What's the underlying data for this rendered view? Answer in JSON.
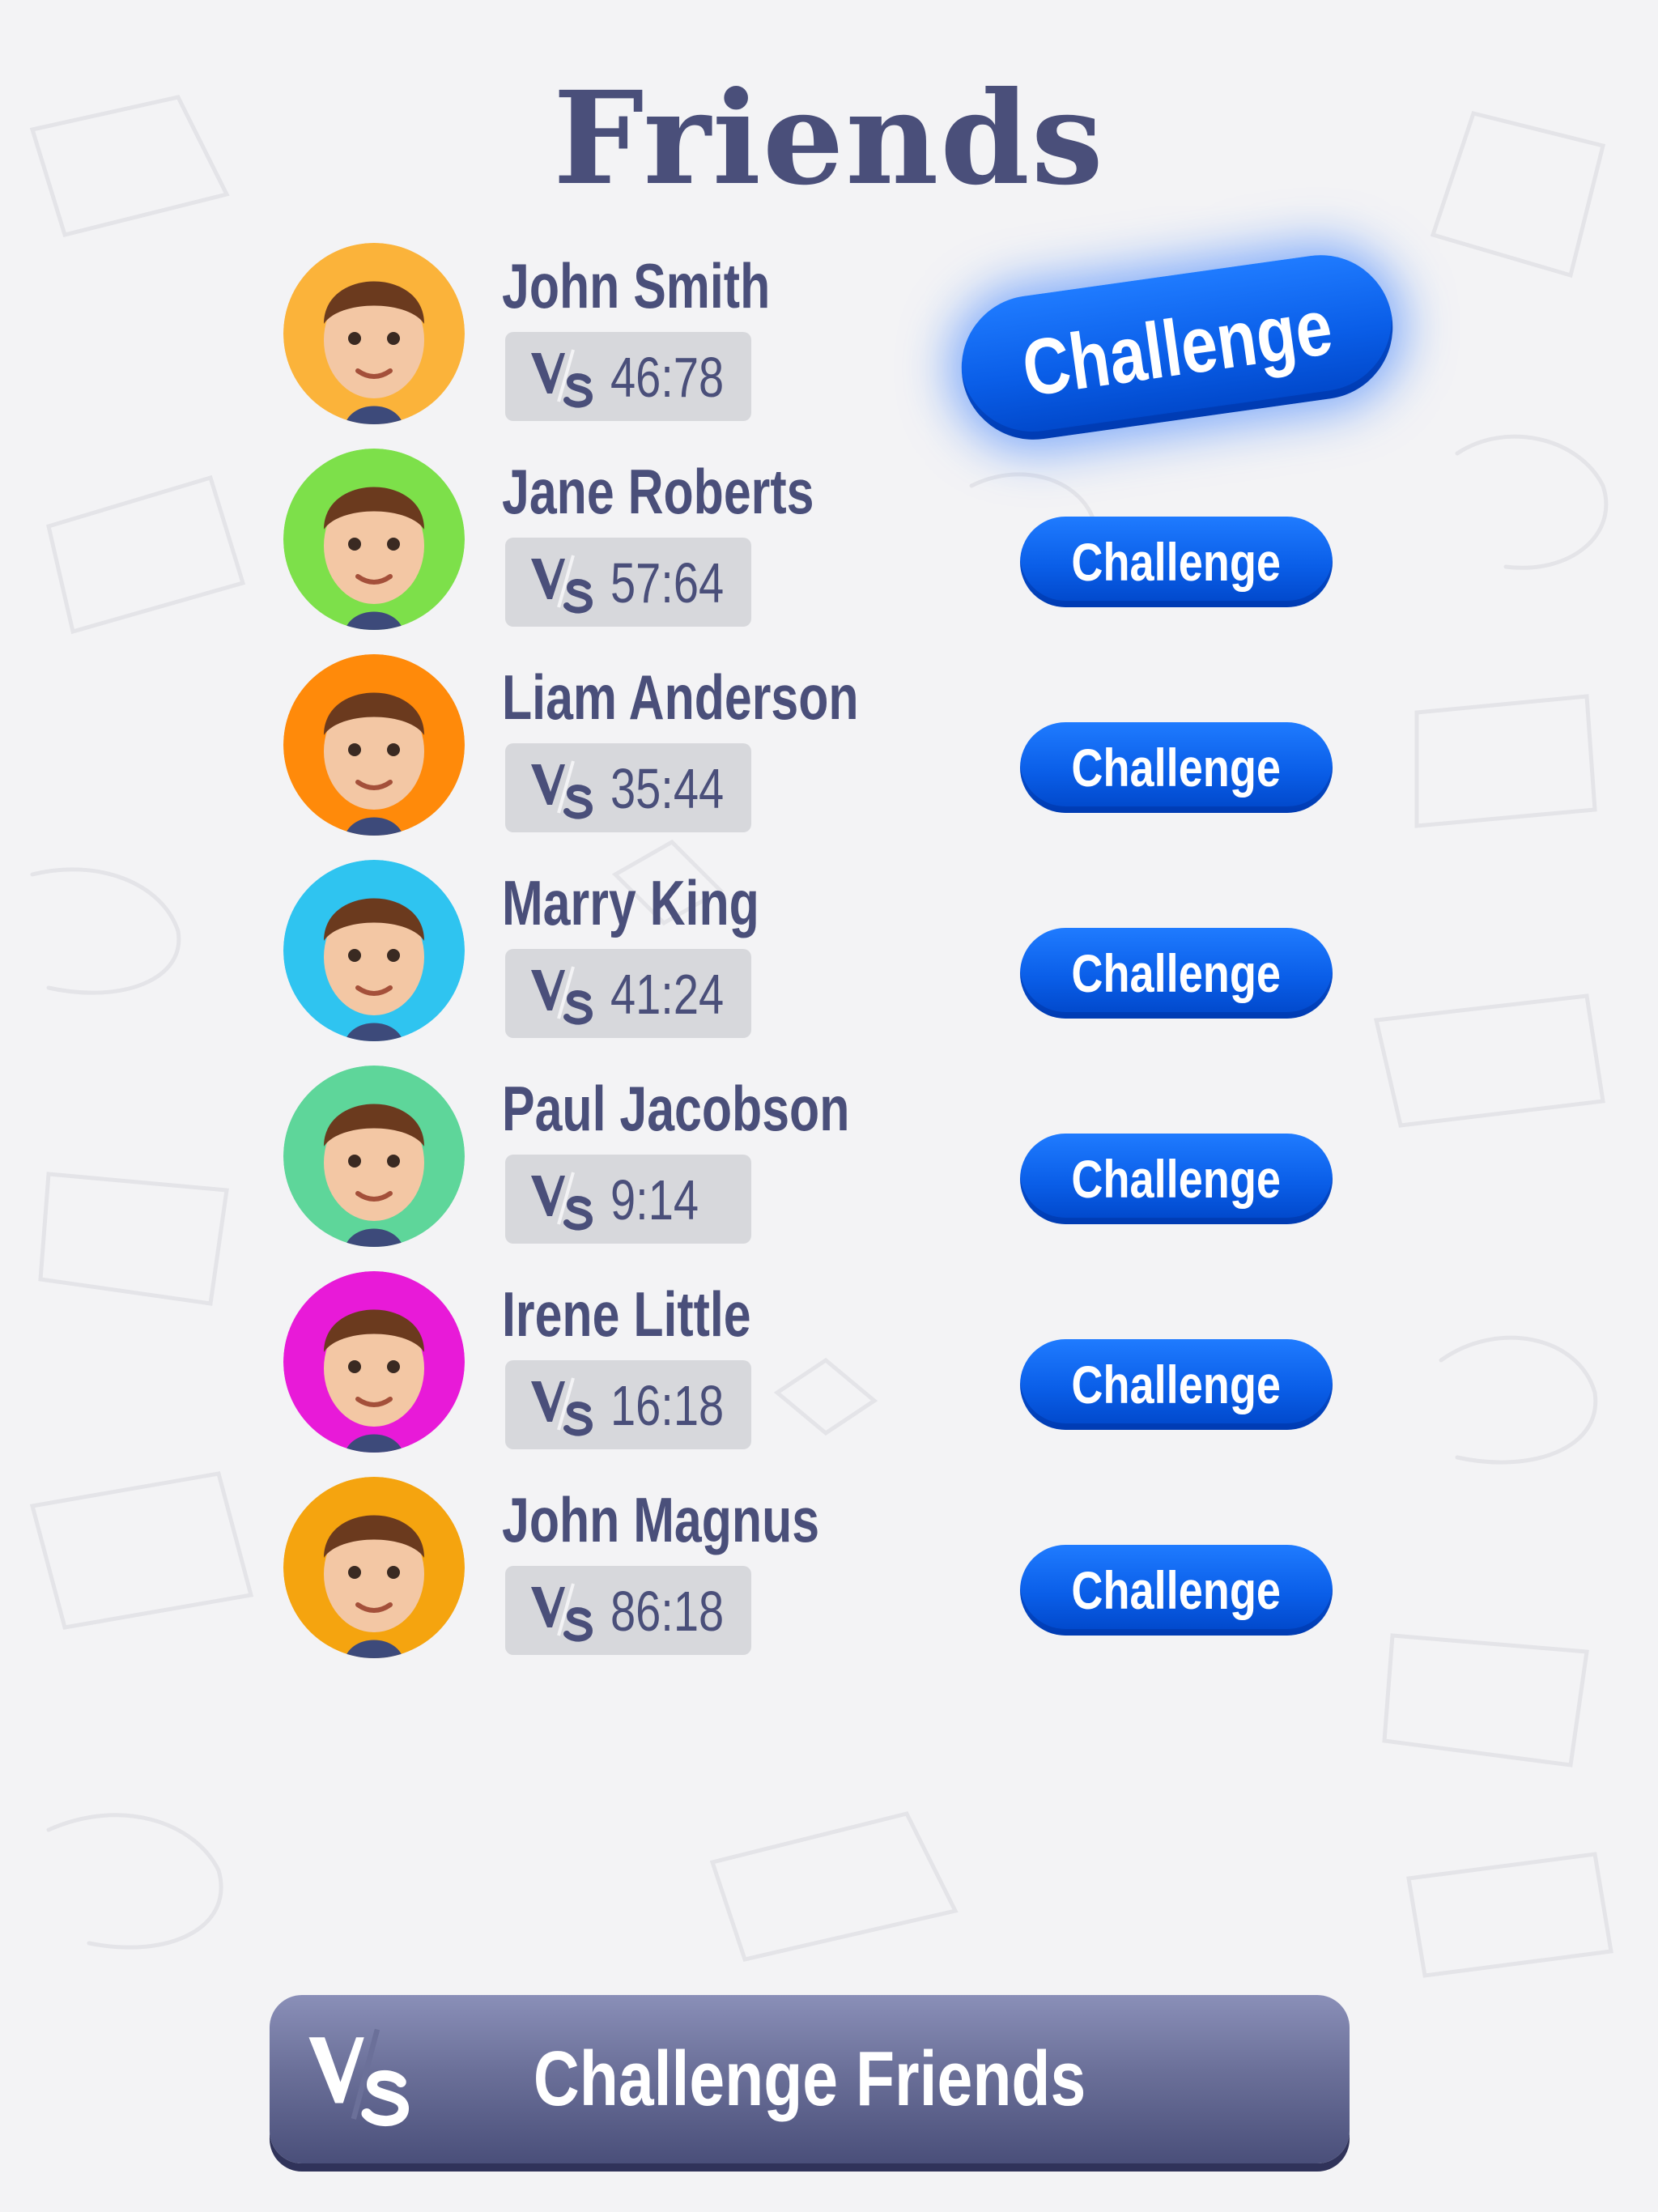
{
  "page": {
    "title": "Friends"
  },
  "friends": [
    {
      "name": "John Smith",
      "score": "46:78",
      "avatar_color": "#fbb33a",
      "challenge_label": "Challenge",
      "highlighted": true
    },
    {
      "name": "Jane Roberts",
      "score": "57:64",
      "avatar_color": "#7de04a",
      "challenge_label": "Challenge",
      "highlighted": false
    },
    {
      "name": "Liam Anderson",
      "score": "35:44",
      "avatar_color": "#ff8a0a",
      "challenge_label": "Challenge",
      "highlighted": false
    },
    {
      "name": "Marry King",
      "score": "41:24",
      "avatar_color": "#2fc4f0",
      "challenge_label": "Challenge",
      "highlighted": false
    },
    {
      "name": "Paul Jacobson",
      "score": "9:14",
      "avatar_color": "#5ed69a",
      "challenge_label": "Challenge",
      "highlighted": false
    },
    {
      "name": "Irene Little",
      "score": "16:18",
      "avatar_color": "#e81ad8",
      "challenge_label": "Challenge",
      "highlighted": false
    },
    {
      "name": "John Magnus",
      "score": "86:18",
      "avatar_color": "#f5a40f",
      "challenge_label": "Challenge",
      "highlighted": false
    }
  ],
  "footer": {
    "button_label": "Challenge Friends"
  },
  "colors": {
    "text_primary": "#4a4f7a",
    "button_blue": "#0a5ee8",
    "score_box": "#d7d8dc",
    "background": "#f3f3f5"
  },
  "icons": {
    "vs": "vs-icon"
  }
}
